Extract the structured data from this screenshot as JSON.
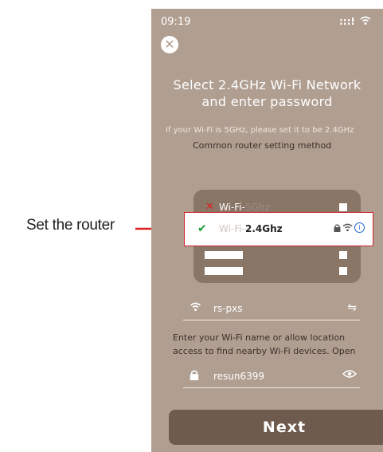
{
  "annotation": {
    "label": "Set the router"
  },
  "status_bar": {
    "time": "09:19",
    "signal": ":::!",
    "wifi": "⌣"
  },
  "header": {
    "title_line1": "Select 2.4GHz Wi-Fi Network",
    "title_line2": "and enter password",
    "hint": "If your Wi-Fi is 5GHz, please set it to be 2.4GHz",
    "link": "Common router setting method"
  },
  "router": {
    "rows": [
      {
        "status": "✕",
        "prefix": "Wi-Fi-",
        "suffix": "5Ghz"
      },
      {
        "status": "✔",
        "prefix": "Wi-Fi-",
        "suffix": "2.4Ghz"
      }
    ]
  },
  "network_field": {
    "value": "rs-pxs",
    "icon": "wifi-icon",
    "action_icon": "switch-icon"
  },
  "message": {
    "line1": "Enter your Wi-Fi name or allow location",
    "line2": "access to find nearby Wi-Fi devices. Open"
  },
  "password_field": {
    "value": "resun6399",
    "icon": "lock-icon",
    "action_icon": "eye-icon"
  },
  "next_button": {
    "label": "Next"
  },
  "colors": {
    "accent_red": "#d1242f",
    "background": "#b09e91",
    "button": "#6e5b4e"
  }
}
